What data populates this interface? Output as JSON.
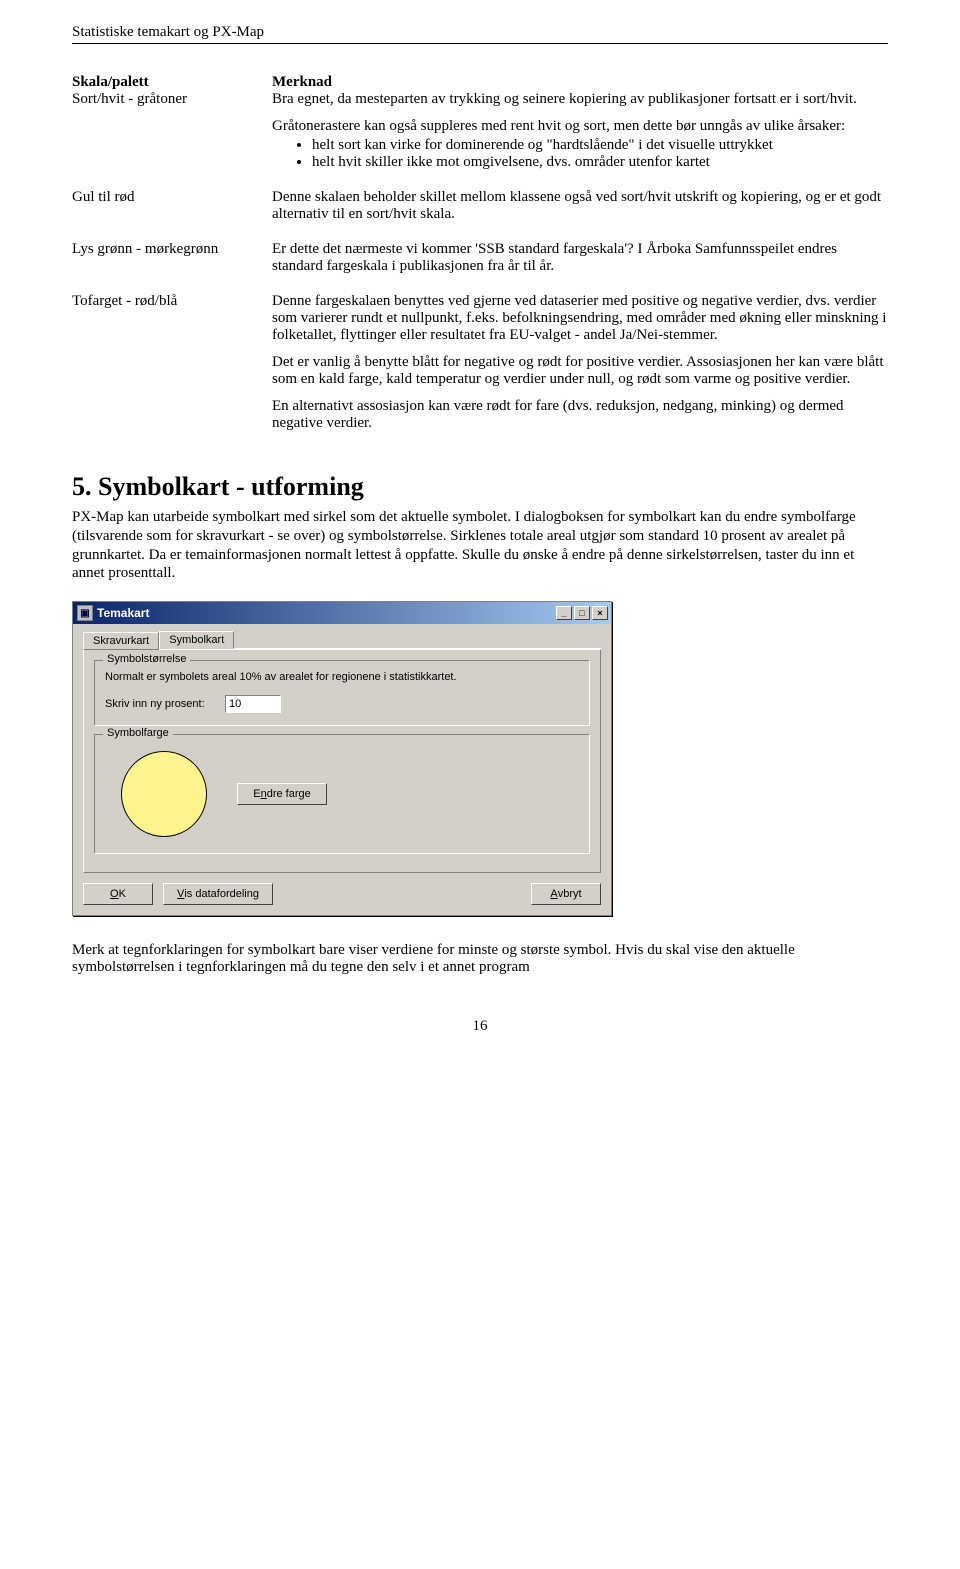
{
  "header": "Statistiske temakart og PX-Map",
  "table": {
    "header_left": "Skala/palett",
    "header_right": "Merknad",
    "rows": [
      {
        "label": "Sort/hvit - gråtoner",
        "p1": "Bra egnet, da mesteparten av trykking og seinere kopiering av publikasjoner fortsatt er i sort/hvit.",
        "p2": "Gråtonerastere kan også suppleres med rent hvit og sort, men dette bør unngås av ulike årsaker:",
        "b1": "helt sort kan virke for dominerende og \"hardtslående\" i det visuelle uttrykket",
        "b2": "helt hvit skiller ikke mot omgivelsene, dvs. områder utenfor kartet"
      },
      {
        "label": "Gul til rød",
        "p1": "Denne skalaen beholder skillet mellom klassene også ved sort/hvit utskrift og kopiering, og er et godt alternativ til en sort/hvit skala."
      },
      {
        "label": "Lys grønn  - mørkegrønn",
        "p1": "Er dette det nærmeste vi kommer 'SSB standard fargeskala'? I Årboka Samfunnsspeilet endres standard fargeskala i publikasjonen fra år til år."
      },
      {
        "label": "Tofarget - rød/blå",
        "p1": "Denne fargeskalaen benyttes ved gjerne ved dataserier med positive og negative verdier, dvs. verdier som varierer rundt et nullpunkt, f.eks. befolkningsendring, med områder med økning eller minskning i folketallet, flyttinger eller resultatet fra EU-valget - andel Ja/Nei-stemmer.",
        "p2": "Det er vanlig å benytte blått for negative og rødt for positive verdier. Assosiasjonen her kan være blått som en kald farge, kald temperatur og verdier under null, og rødt som varme og positive verdier.",
        "p3": "En alternativt assosiasjon kan være rødt for fare (dvs. reduksjon, nedgang, minking) og dermed negative verdier."
      }
    ]
  },
  "section": {
    "heading": "5.    Symbolkart - utforming",
    "p1": "PX-Map kan utarbeide symbolkart med sirkel som det aktuelle symbolet. I dialogboksen for symbolkart kan du endre symbolfarge (tilsvarende som for skravurkart - se over) og symbolstørrelse. Sirklenes totale areal utgjør som standard 10 prosent av arealet på grunnkartet. Da er temainformasjonen normalt lettest å oppfatte. Skulle du ønske å endre på denne sirkelstørrelsen, taster du inn et annet prosenttall."
  },
  "dialog": {
    "title": "Temakart",
    "tabs": {
      "t1": "Skravurkart",
      "t2": "Symbolkart"
    },
    "group1": {
      "title": "Symbolstørrelse",
      "note": "Normalt er symbolets areal 10% av arealet for regionene i statistikkartet.",
      "label": "Skriv inn ny prosent:",
      "value": "10"
    },
    "group2": {
      "title": "Symbolfarge",
      "change_btn_pre": "E",
      "change_btn_u": "n",
      "change_btn_post": "dre farge"
    },
    "buttons": {
      "ok_u": "O",
      "ok_post": "K",
      "vis_u": "V",
      "vis_post": "is datafordeling",
      "avbryt_u": "A",
      "avbryt_post": "vbryt"
    },
    "winbtn_min": "_",
    "winbtn_max": "□",
    "winbtn_close": "×"
  },
  "after": "Merk at tegnforklaringen for symbolkart bare viser verdiene for minste og største symbol. Hvis du skal vise den aktuelle symbolstørrelsen i tegnforklaringen må du tegne den selv i et annet program",
  "page_num": "16"
}
